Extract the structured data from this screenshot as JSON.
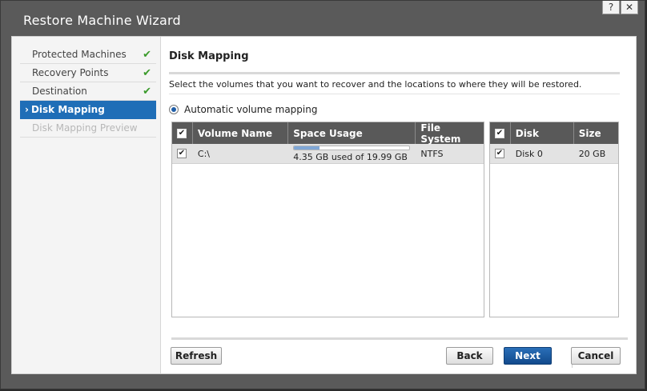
{
  "window": {
    "title": "Restore Machine Wizard",
    "help_label": "?",
    "close_label": "✕"
  },
  "sidebar": {
    "items": [
      {
        "label": "Protected Machines",
        "state": "done"
      },
      {
        "label": "Recovery Points",
        "state": "done"
      },
      {
        "label": "Destination",
        "state": "done"
      },
      {
        "label": "Disk Mapping",
        "state": "active"
      },
      {
        "label": "Disk Mapping Preview",
        "state": "disabled"
      }
    ],
    "check_glyph": "✔",
    "active_glyph": "›"
  },
  "main": {
    "heading": "Disk Mapping",
    "description": "Select the volumes that you want to recover and the locations to where they will be restored.",
    "mapping_option": "Automatic volume mapping"
  },
  "volumes_table": {
    "columns": [
      "Volume Name",
      "Space Usage",
      "File System"
    ],
    "rows": [
      {
        "checked": true,
        "name": "C:\\",
        "usage_text": "4.35 GB used of 19.99 GB",
        "usage_fraction": 0.218,
        "file_system": "NTFS"
      }
    ]
  },
  "disks_table": {
    "columns": [
      "Disk",
      "Size"
    ],
    "rows": [
      {
        "checked": true,
        "disk": "Disk 0",
        "size": "20 GB"
      }
    ]
  },
  "buttons": {
    "refresh": "Refresh",
    "back": "Back",
    "next": "Next",
    "cancel": "Cancel"
  },
  "colors": {
    "accent": "#1f6eb7",
    "header": "#595959",
    "check_green": "#3a9a2a"
  }
}
